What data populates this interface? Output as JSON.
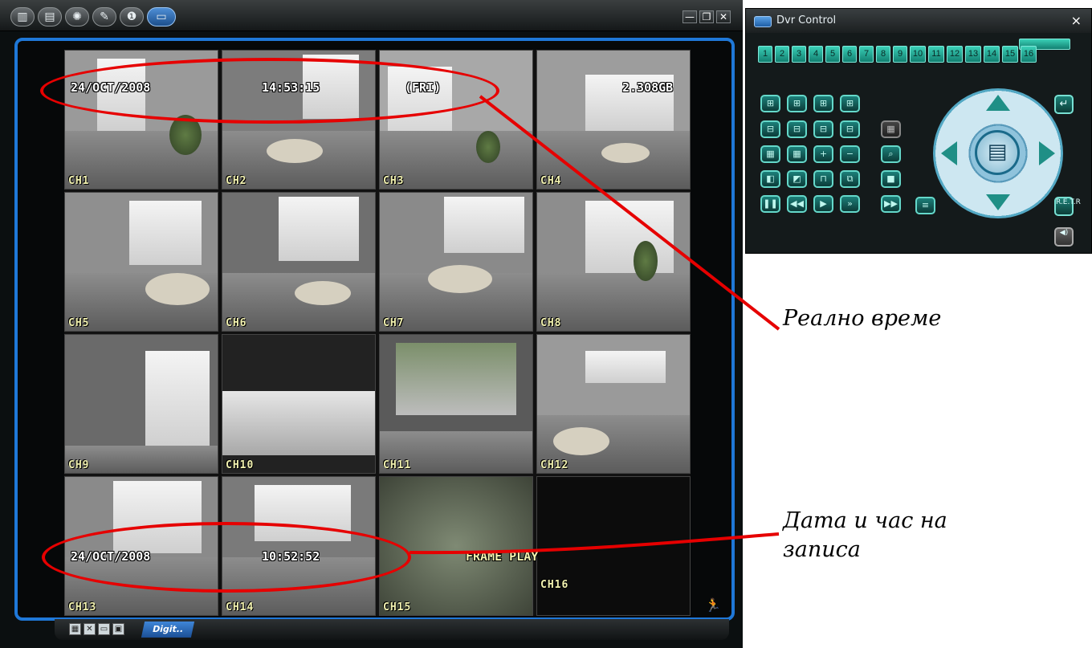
{
  "toolbar": {
    "icons": [
      "layout-icon",
      "document-icon",
      "network-icon",
      "tools-icon",
      "info-icon",
      "dvr-control-icon"
    ]
  },
  "window_controls": {
    "minimize": "—",
    "restore": "❐",
    "close": "✕"
  },
  "grid": {
    "top_osd": {
      "date": "24/OCT/2008",
      "time": "14:53:15",
      "day": "(FRI)",
      "storage": "2.308GB"
    },
    "bottom_osd": {
      "date": "24/OCT/2008",
      "time": "10:52:52",
      "mode": "FRAME PLAY"
    },
    "channels": [
      "CH1",
      "CH2",
      "CH3",
      "CH4",
      "CH5",
      "CH6",
      "CH7",
      "CH8",
      "CH9",
      "CH10",
      "CH11",
      "CH12",
      "CH13",
      "CH14",
      "CH15",
      "CH16"
    ]
  },
  "bottombar": {
    "tab_label": "Digit.."
  },
  "dvr": {
    "title": "Dvr Control",
    "close": "×",
    "channel_buttons": [
      "1",
      "2",
      "3",
      "4",
      "5",
      "6",
      "7",
      "8",
      "9",
      "10",
      "11",
      "12",
      "13",
      "14",
      "15",
      "16"
    ],
    "enter_label": "↵",
    "retr_label": "R.E.T.R",
    "side_label": "◀)"
  },
  "annotations": {
    "real_time": "Реално време",
    "record_time_line1": "Дата и час на",
    "record_time_line2": "записа"
  },
  "colors": {
    "accent": "#1f78d8",
    "annotation": "#e60000",
    "panel_button": "#3ad0b7"
  }
}
